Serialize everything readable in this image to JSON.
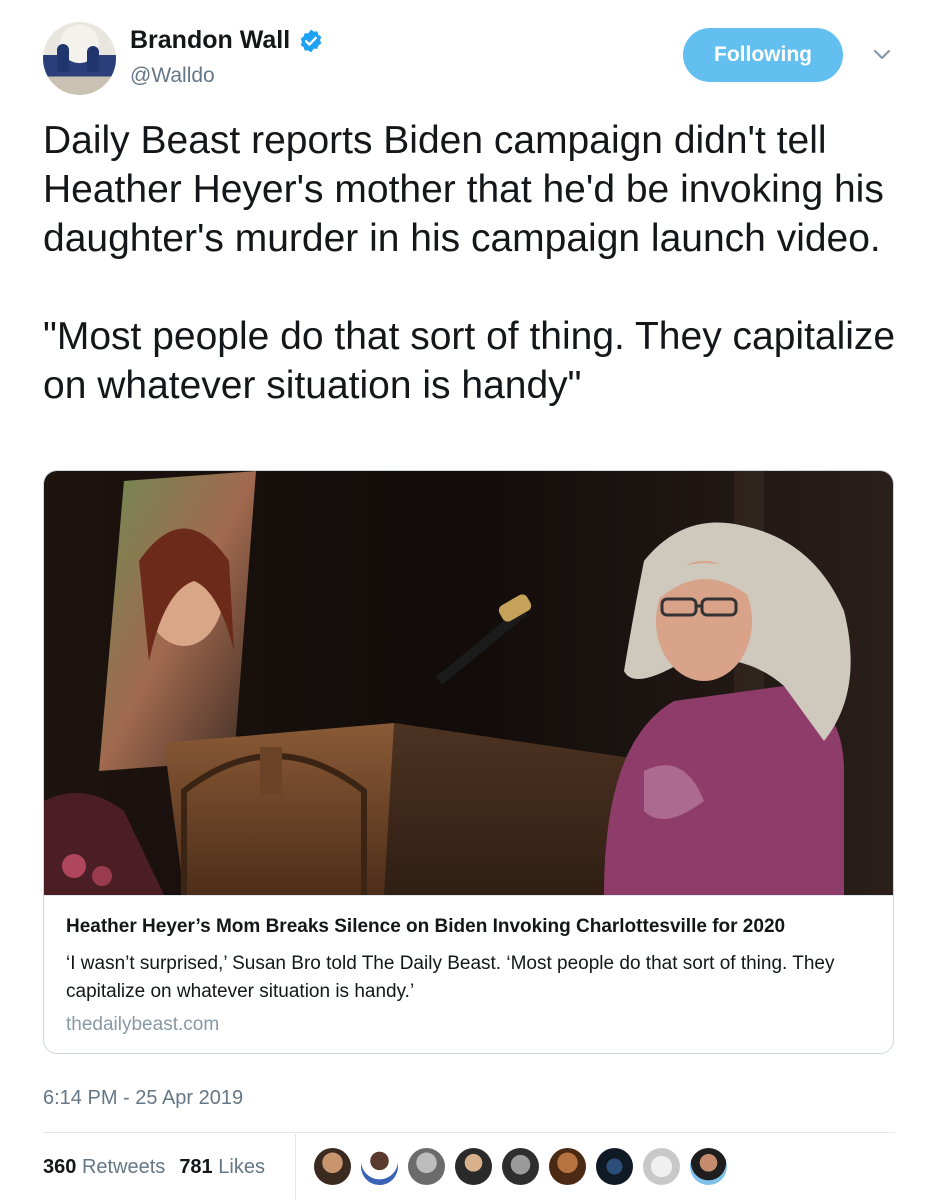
{
  "author": {
    "name": "Brandon Wall",
    "handle": "@Walldo",
    "follow_label": "Following"
  },
  "tweet": {
    "paragraphs": [
      "Daily Beast reports Biden campaign didn't tell Heather Heyer's mother that he'd be invoking his daughter's murder in his campaign launch video.",
      "\"Most people do that sort of thing. They capitalize on whatever situation is handy\""
    ]
  },
  "card": {
    "title": "Heather Heyer’s Mom Breaks Silence on Biden Invoking Charlottesville for 2020",
    "description": "‘I wasn’t surprised,’ Susan Bro told The Daily Beast. ‘Most people do that sort of thing. They capitalize on whatever situation is handy.’",
    "domain": "thedailybeast.com"
  },
  "timestamp": "6:14 PM - 25 Apr 2019",
  "stats": {
    "retweets_count": "360",
    "retweets_label": "Retweets",
    "likes_count": "781",
    "likes_label": "Likes"
  },
  "icons": {
    "verified": "verified-badge-icon",
    "caret": "chevron-down-icon"
  },
  "colors": {
    "follow_button": "#63bfef",
    "secondary_text": "#657786",
    "verified": "#1da1f2"
  }
}
